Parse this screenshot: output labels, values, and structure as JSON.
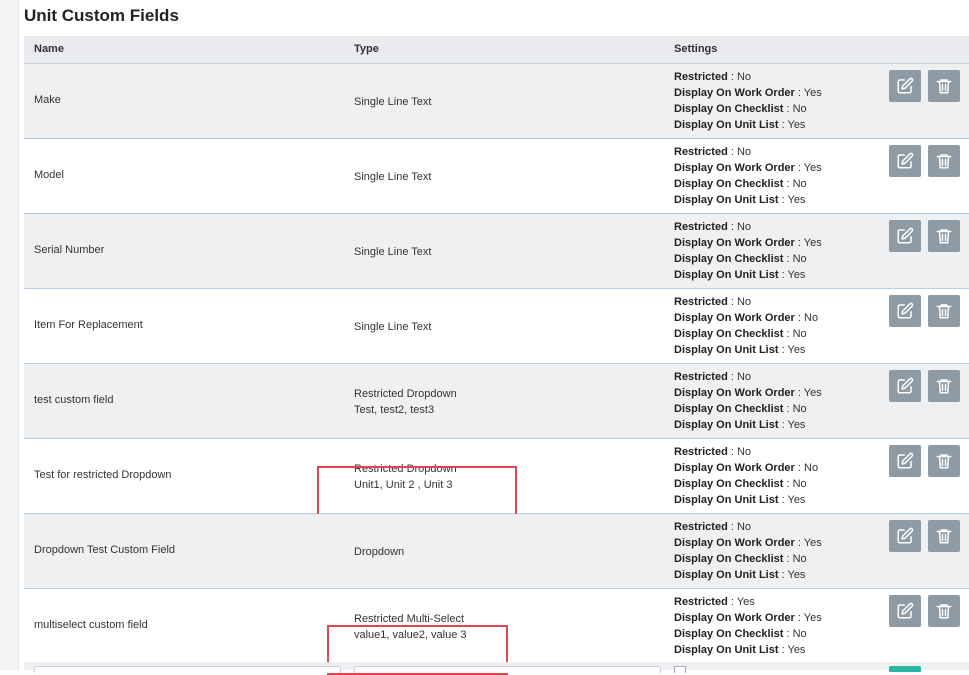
{
  "page": {
    "title": "Unit Custom Fields"
  },
  "table": {
    "headers": {
      "name": "Name",
      "type": "Type",
      "settings": "Settings"
    },
    "setting_labels": {
      "restricted": "Restricted",
      "work_order": "Display On Work Order",
      "checklist": "Display On Checklist",
      "unit_list": "Display On Unit List"
    },
    "rows": [
      {
        "name": "Make",
        "type": "Single Line Text",
        "type_values": "",
        "restricted": " : No",
        "work_order": " : Yes",
        "checklist": " : No",
        "unit_list": " : Yes"
      },
      {
        "name": "Model",
        "type": "Single Line Text",
        "type_values": "",
        "restricted": " : No",
        "work_order": " : Yes",
        "checklist": " : No",
        "unit_list": " : Yes"
      },
      {
        "name": "Serial Number",
        "type": "Single Line Text",
        "type_values": "",
        "restricted": " : No",
        "work_order": " : Yes",
        "checklist": " : No",
        "unit_list": " : Yes"
      },
      {
        "name": "Item For Replacement",
        "type": "Single Line Text",
        "type_values": "",
        "restricted": " : No",
        "work_order": " : No",
        "checklist": " : No",
        "unit_list": " : Yes"
      },
      {
        "name": "test custom field",
        "type": "Restricted Dropdown",
        "type_values": "Test, test2, test3",
        "restricted": " : No",
        "work_order": " : Yes",
        "checklist": " : No",
        "unit_list": " : Yes"
      },
      {
        "name": "Test for restricted Dropdown",
        "type": "Restricted Dropdown",
        "type_values": "Unit1, Unit 2 , Unit 3",
        "restricted": " : No",
        "work_order": " : No",
        "checklist": " : No",
        "unit_list": " : Yes"
      },
      {
        "name": "Dropdown Test Custom Field",
        "type": "Dropdown",
        "type_values": "",
        "restricted": " : No",
        "work_order": " : Yes",
        "checklist": " : No",
        "unit_list": " : Yes"
      },
      {
        "name": "multiselect custom field",
        "type": "Restricted Multi-Select",
        "type_values": "value1, value2, value 3",
        "restricted": " : Yes",
        "work_order": " : Yes",
        "checklist": " : No",
        "unit_list": " : Yes"
      }
    ]
  },
  "icons": {
    "edit": "edit-icon",
    "delete": "trash-icon"
  },
  "colors": {
    "button": "#8e9ba4",
    "highlight": "#e0464b",
    "row_alt": "#eef0f2",
    "add_button": "#2bb6a3"
  }
}
